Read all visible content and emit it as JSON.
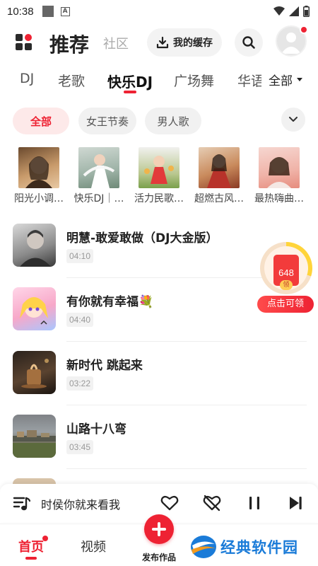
{
  "status_bar": {
    "time": "10:38"
  },
  "header": {
    "title": "推荐",
    "community_tab": "社区",
    "cache_button": "我的缓存"
  },
  "category_tabs": {
    "items": [
      "DJ",
      "老歌",
      "快乐DJ",
      "广场舞",
      "华语"
    ],
    "active": "快乐DJ",
    "all_label": "全部"
  },
  "filter_chips": {
    "items": [
      "全部",
      "女王节奏",
      "男人歌"
    ],
    "active": "全部"
  },
  "playlists": [
    {
      "label": "阳光小调…"
    },
    {
      "label": "快乐DJ｜…"
    },
    {
      "label": "活力民歌…"
    },
    {
      "label": "超燃古风…"
    },
    {
      "label": "最热嗨曲…"
    }
  ],
  "songs": [
    {
      "title": "明慧-敢爱敢做（DJ大金版）",
      "duration": "04:10"
    },
    {
      "title": "有你就有幸福💐",
      "duration": "04:40"
    },
    {
      "title": "新时代 跳起来",
      "duration": "03:22"
    },
    {
      "title": "山路十八弯",
      "duration": "03:45"
    }
  ],
  "red_packet": {
    "amount": "648",
    "coin_label": "领",
    "button_label": "点击可领"
  },
  "mini_player": {
    "now_playing": "时侯你就来看我"
  },
  "bottom_nav": {
    "home": "首页",
    "video": "视频",
    "publish": "发布作品"
  },
  "watermark": {
    "text": "经典软件园"
  },
  "colors": {
    "accent": "#ee2233",
    "chip_active_bg": "#fde9e9",
    "watermark_blue": "#1a7bd8"
  }
}
